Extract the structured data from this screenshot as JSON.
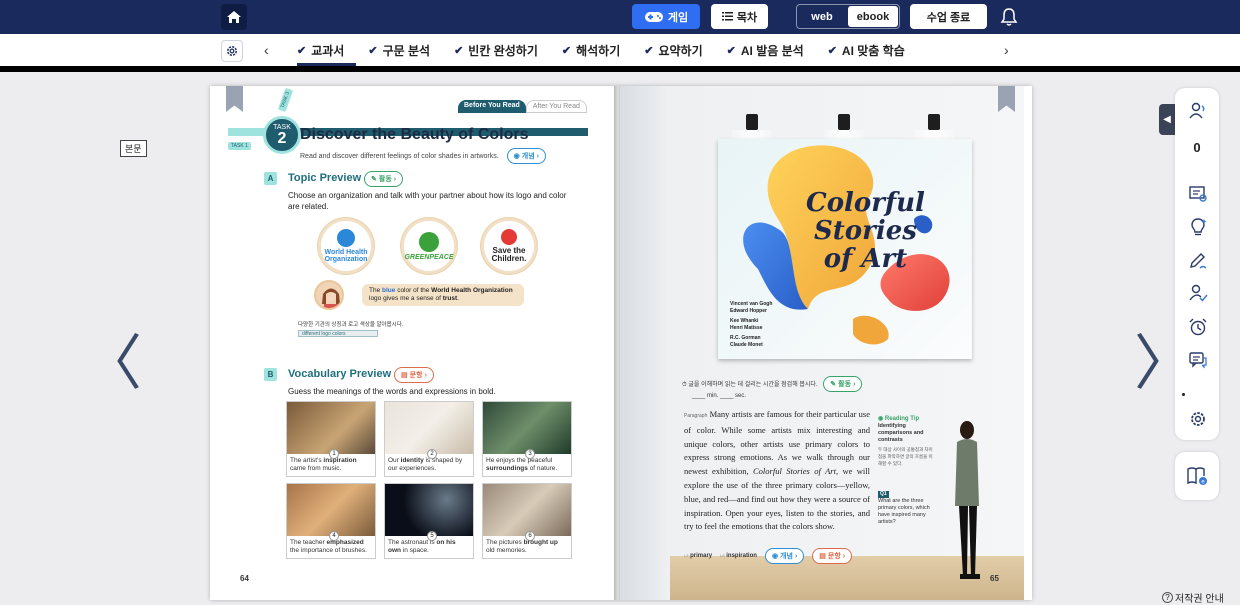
{
  "topbar": {
    "game_label": "게임",
    "toc_label": "목차",
    "view_modes": [
      "web",
      "ebook"
    ],
    "active_view": "ebook",
    "end_class_label": "수업 종료"
  },
  "tabs": [
    {
      "label": "교과서",
      "active": true
    },
    {
      "label": "구문 분석",
      "active": false
    },
    {
      "label": "빈칸 완성하기",
      "active": false
    },
    {
      "label": "해석하기",
      "active": false
    },
    {
      "label": "요약하기",
      "active": false
    },
    {
      "label": "AI 발음 분석",
      "active": false
    },
    {
      "label": "AI 맞춤 학습",
      "active": false
    }
  ],
  "viewer": {
    "bonmun_label": "본문",
    "prev_arrow": "〈",
    "next_arrow": "〉"
  },
  "left_page": {
    "task_label": "TASK",
    "task_number": "2",
    "task_side_labels": [
      "TASK 1",
      "TASK 3"
    ],
    "before_label": "Before You Read",
    "after_label": "After You Read",
    "title": "Discover the Beauty of Colors",
    "subtitle": "Read and discover different feelings of color shades in artworks.",
    "concept_pill": "개념",
    "section_a": {
      "mark": "A",
      "title": "Topic Preview",
      "pill": "활동",
      "instruction": "Choose an organization and talk with your partner about how its logo and color are related.",
      "logos": [
        {
          "line1": "World Health",
          "line2": "Organization"
        },
        {
          "line1": "GREENPEACE",
          "line2": ""
        },
        {
          "line1": "Save the",
          "line2": "Children."
        }
      ],
      "speech_pre": "The ",
      "speech_bold1": "blue",
      "speech_mid": " color of the ",
      "speech_bold2": "World Health Organization",
      "speech_post": " logo gives me a sense of ",
      "speech_bold3": "trust",
      "speech_end": ".",
      "note_label": "다양한 기관의 상징과 로고 색상을 알아봅시다.",
      "note_input": "different logo colors"
    },
    "section_b": {
      "mark": "B",
      "title": "Vocabulary Preview",
      "pill": "문항",
      "instruction": "Guess the meanings of the words and expressions in bold.",
      "items": [
        {
          "num": "1",
          "pre": "The artist's ",
          "bold": "inspiration",
          "post": " came from music."
        },
        {
          "num": "2",
          "pre": "Our ",
          "bold": "identity",
          "post": " is shaped by our experiences."
        },
        {
          "num": "3",
          "pre": "He enjoys the peaceful ",
          "bold": "surroundings",
          "post": " of nature."
        },
        {
          "num": "4",
          "pre": "The teacher ",
          "bold": "emphasized",
          "post": " the importance of brushes."
        },
        {
          "num": "5",
          "pre": "The astronaut is ",
          "bold": "on his own",
          "post": " in space."
        },
        {
          "num": "6",
          "pre": "The pictures ",
          "bold": "brought up",
          "post": " old memories."
        }
      ]
    },
    "page_number": "64"
  },
  "right_page": {
    "poster_title_lines": [
      "Colorful",
      "Stories",
      "of Art"
    ],
    "poster_names": [
      "Vincent van Gogh",
      "Edward Hopper",
      "Kee Whanki",
      "Henri Matisse",
      "R.C. Gorman",
      "Claude Monet"
    ],
    "timer_text": "글을 이해하며 읽는 데 걸리는 시간을 점검해 봅시다.",
    "timer_units": [
      "min.",
      "sec."
    ],
    "timer_pill": "활동",
    "reading_label": "Paragraph",
    "reading_text_1": "Many artists are famous for their particular use of color. While some artists mix interesting and unique colors, other artists use primary colors to express strong emotions. As we walk through our newest exhibition, ",
    "reading_italic": "Colorful Stories of Art",
    "reading_text_2": ", we will explore the use of the three primary colors—yellow, blue, and red—and find out how they were a source of inspiration. Open your eyes, listen to the stories, and try to feel the emotions that the colors show.",
    "tip_title": "Reading Tip",
    "tip_sub": "Identifying comparisons and contrasts",
    "tip_note": "두 대상 사이의 공통점과 차이점을 파악하면 글의 흐름을 이해할 수 있다.",
    "tip_q_label": "Q1",
    "tip_question": "What are the three primary colors, which have inspired many artists?",
    "foot_words": [
      {
        "num": "L3",
        "word": "primary"
      },
      {
        "num": "L8",
        "word": "inspiration"
      }
    ],
    "concept_pill": "개념",
    "question_pill": "문항",
    "page_number": "65"
  },
  "rail": {
    "participant_count": "0"
  },
  "footer": {
    "copyright_label": "저작권 안내"
  }
}
